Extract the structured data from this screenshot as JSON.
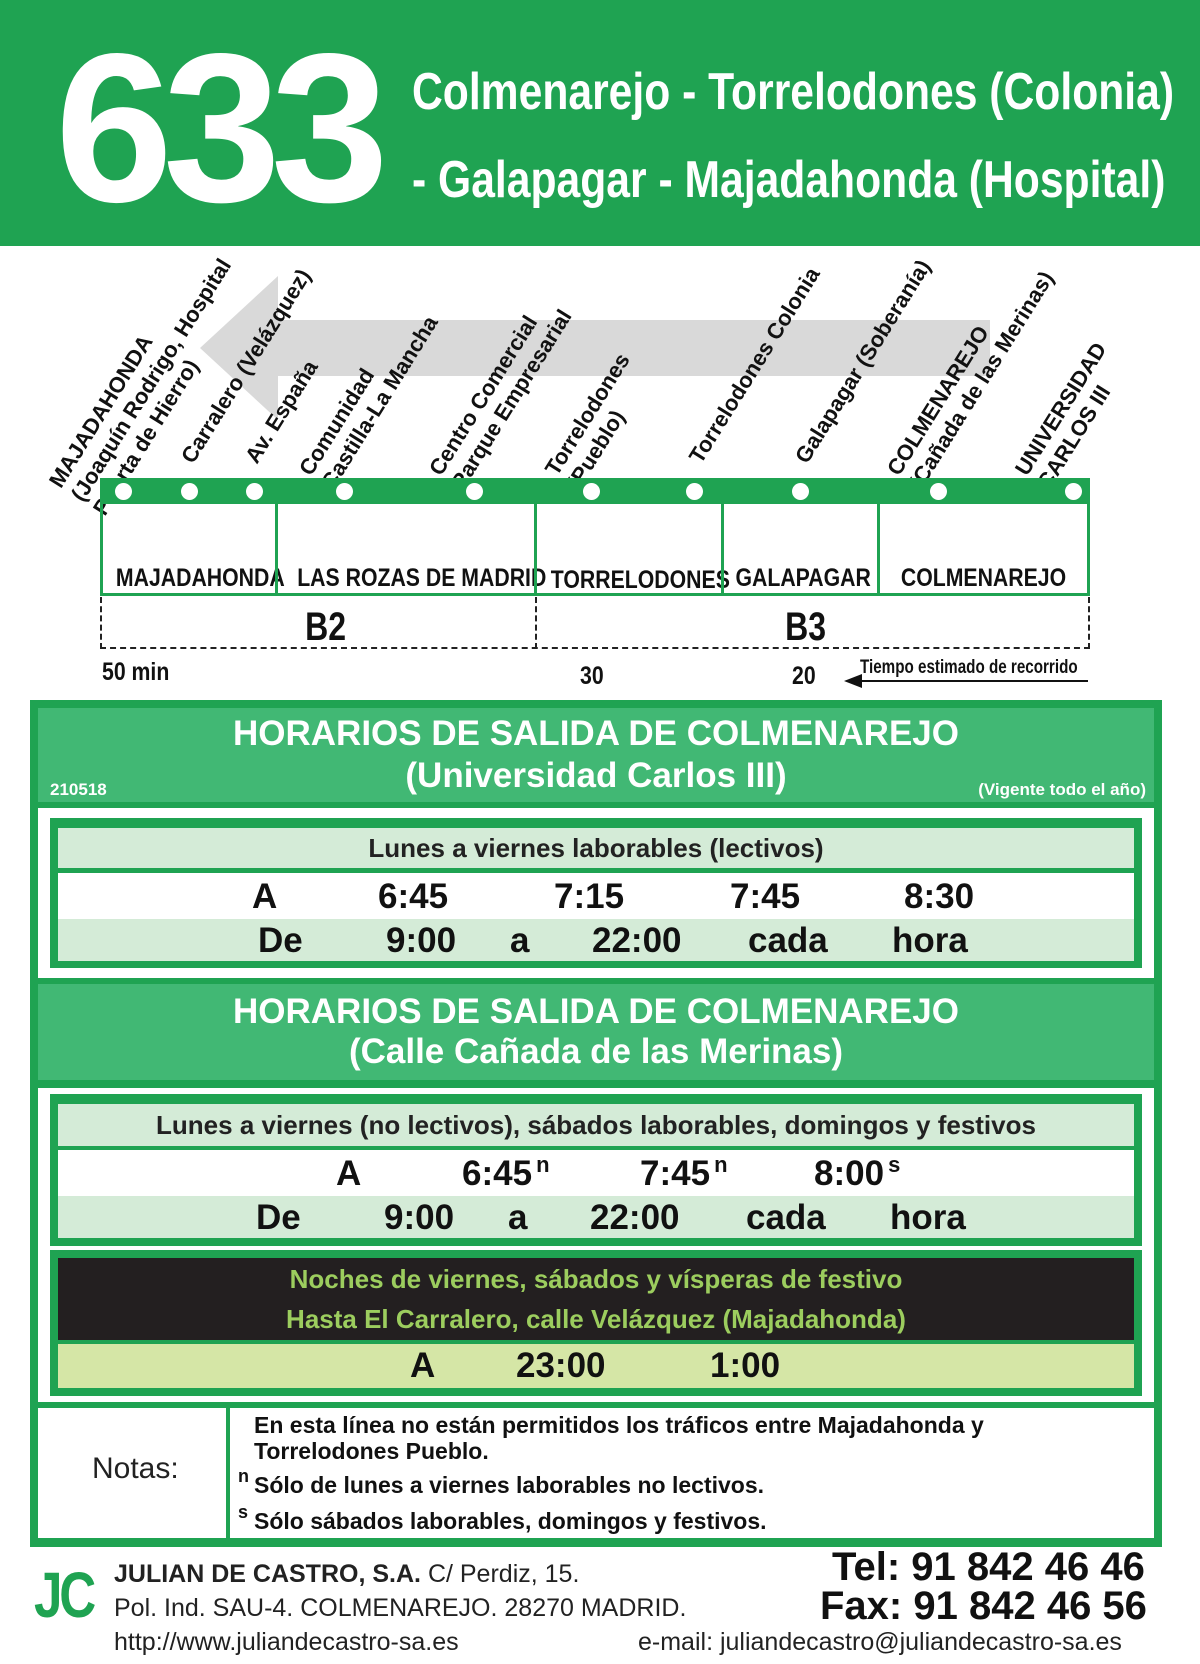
{
  "header": {
    "line_number": "633",
    "route_line1": "Colmenarejo - Torrelodones (Colonia)",
    "route_line2": "- Galapagar - Majadahonda (Hospital)"
  },
  "stops": [
    "MAJADAHONDA\n(Joaquín Rodrigo, Hospital\nPuerta de Hierro)",
    "Carralero (Velázquez)",
    "Av. España",
    "Comunidad\nCastilla-La Mancha",
    "Centro Comercial\nParque Empresarial",
    "Torrelodones\n(Pueblo)",
    "Torrelodones Colonia",
    "Galapagar (Soberanía)",
    "COLMENAREJO\n(Cañada de las Merinas)",
    "UNIVERSIDAD\nCARLOS III"
  ],
  "municipalities": [
    "MAJADAHONDA",
    "LAS ROZAS DE MADRID",
    "TORRELODONES",
    "GALAPAGAR",
    "COLMENAREJO"
  ],
  "zones": [
    "B2",
    "B3"
  ],
  "travel_times": {
    "t1": "50 min",
    "t2": "30",
    "t3": "20",
    "label": "Tiempo estimado de recorrido"
  },
  "section1": {
    "title_line1": "HORARIOS DE SALIDA DE COLMENAREJO",
    "title_line2": "(Universidad Carlos III)",
    "code": "210518",
    "validity": "(Vigente todo el año)",
    "subheading": "Lunes a viernes laborables (lectivos)",
    "row1": [
      "A",
      "6:45",
      "7:15",
      "7:45",
      "8:30"
    ],
    "row2": [
      "De",
      "9:00",
      "a",
      "22:00",
      "cada",
      "hora"
    ]
  },
  "section2": {
    "title_line1": "HORARIOS DE SALIDA DE COLMENAREJO",
    "title_line2": "(Calle Cañada de las Merinas)",
    "subheading": "Lunes a viernes (no lectivos), sábados laborables, domingos y festivos",
    "row1": [
      "A",
      "6:45",
      "7:45",
      "8:00"
    ],
    "row1_marks": [
      "n",
      "n",
      "s"
    ],
    "row2": [
      "De",
      "9:00",
      "a",
      "22:00",
      "cada",
      "hora"
    ],
    "night_line1": "Noches de viernes, sábados y vísperas de festivo",
    "night_line2": "Hasta El Carralero, calle Velázquez (Majadahonda)",
    "night_row": [
      "A",
      "23:00",
      "1:00"
    ]
  },
  "notes": {
    "title": "Notas:",
    "line1": "En esta línea no están permitidos los tráficos entre Majadahonda y",
    "line2": "Torrelodones Pueblo.",
    "mark_n": "n",
    "note_n": "Sólo de lunes a viernes laborables no lectivos.",
    "mark_s": "s",
    "note_s": "Sólo sábados laborables, domingos y festivos."
  },
  "footer": {
    "logo": "JC",
    "company": "JULIAN DE CASTRO, S.A.",
    "street": "C/ Perdiz, 15.",
    "address": "Pol. Ind. SAU-4. COLMENAREJO. 28270 MADRID.",
    "website": "http://www.juliandecastro-sa.es",
    "tel": "Tel: 91 842 46 46",
    "fax": "Fax: 91 842 46 56",
    "email": "e-mail: juliandecastro@juliandecastro-sa.es"
  },
  "colors": {
    "brand_green": "#1fa352",
    "title_green": "#41b874",
    "pale_green": "#d4ebd7",
    "night_text": "#9ccd5e",
    "night_row": "#d5e6a6"
  }
}
